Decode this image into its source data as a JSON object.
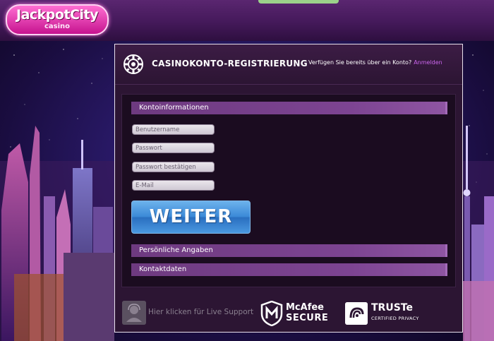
{
  "brand": {
    "logo_main": "JackpotCity",
    "logo_sub": "casino"
  },
  "modal": {
    "title": "CASINOKONTO-REGISTRIERUNG",
    "login_question": "Verfügen Sie bereits über ein Konto?",
    "login_link": "Anmelden"
  },
  "form": {
    "section_account": "Kontoinformationen",
    "fields": {
      "username_placeholder": "Benutzername",
      "password_placeholder": "Passwort",
      "confirm_placeholder": "Passwort bestätigen",
      "email_placeholder": "E-Mail"
    },
    "submit_label": "WEITER",
    "section_personal": "Persönliche Angaben",
    "section_contact": "Kontaktdaten"
  },
  "footer": {
    "support_label": "Hier klicken für Live Support",
    "mcafee_line1": "McAfee",
    "mcafee_line2": "SECURE",
    "truste_line1": "TRUSTe",
    "truste_line2": "CERTIFIED PRIVACY"
  },
  "colors": {
    "accent_purple": "#7d4492",
    "button_blue": "#3c8ad7",
    "link_color": "#cc66ee"
  }
}
